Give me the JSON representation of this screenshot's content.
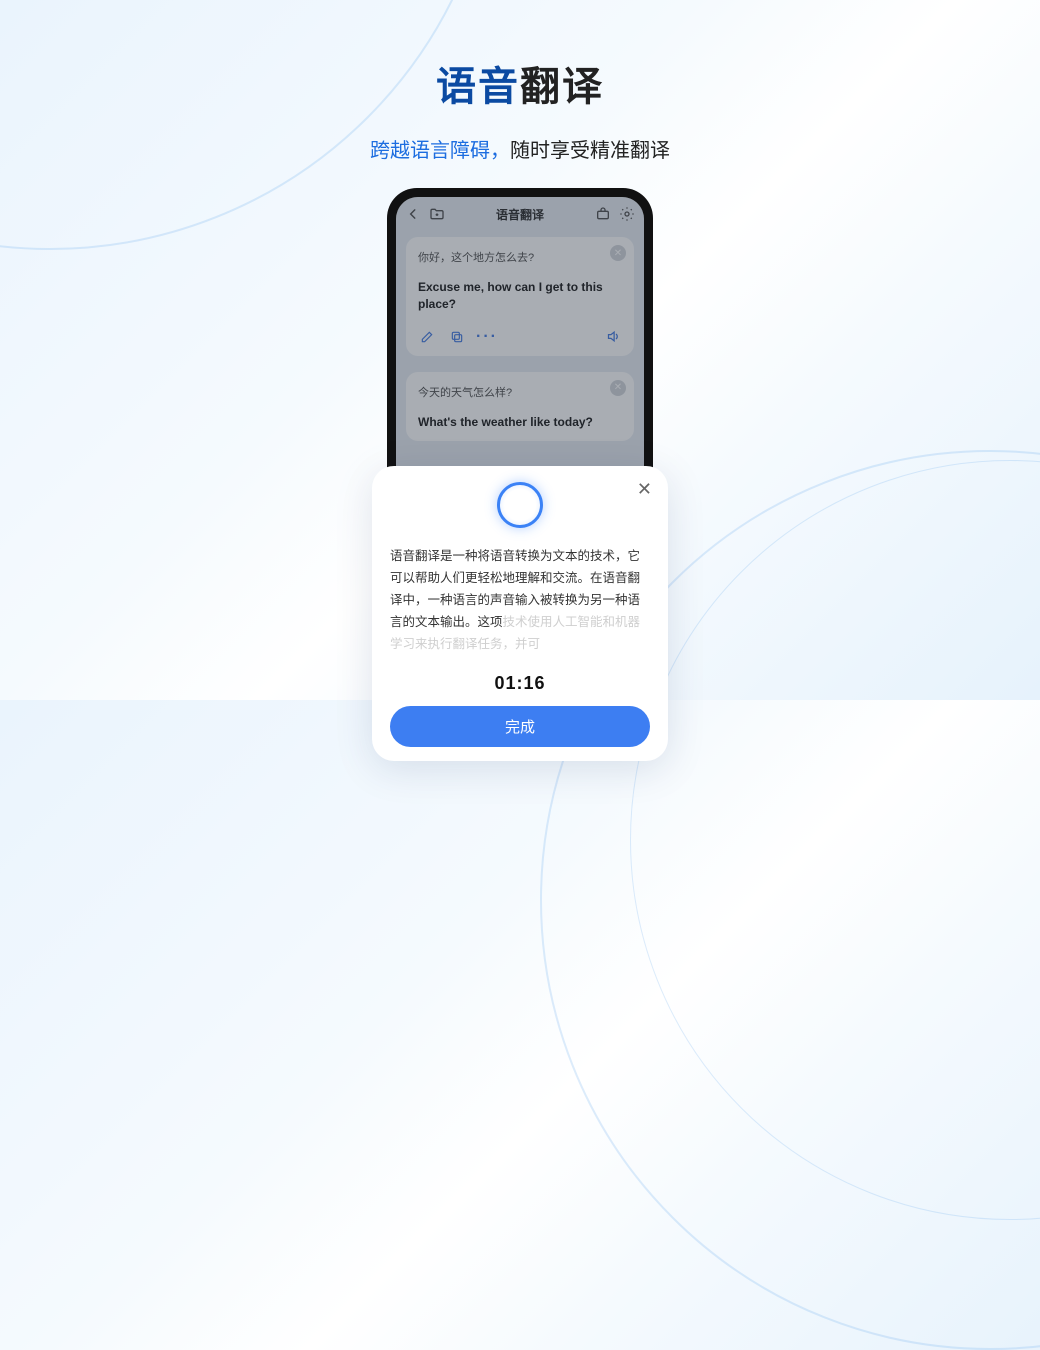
{
  "headline": {
    "part1": "语音",
    "part2": "翻译"
  },
  "subtitle": {
    "part1": "跨越语言障碍，",
    "part2": "随时享受精准翻译"
  },
  "app": {
    "title": "语音翻译",
    "cards": [
      {
        "src": "你好，这个地方怎么去?",
        "dst": "Excuse me, how can I get to this place?"
      },
      {
        "src": "今天的天气怎么样?",
        "dst": "What's the weather like today?"
      }
    ]
  },
  "sheet": {
    "body_main": "语音翻译是一种将语音转换为文本的技术，它可以帮助人们更轻松地理解和交流。在语音翻译中，一种语言的声音输入被转换为另一种语言的文本输出。这项",
    "body_fade": "技术使用人工智能和机器学习来执行翻译任务，并可",
    "timer": "01:16",
    "done": "完成",
    "close": "✕"
  },
  "icons": {
    "back": "chevron-left",
    "folder": "new-folder",
    "briefcase": "toolkit",
    "settings": "gear",
    "edit": "pencil",
    "copy": "copy",
    "more": "…",
    "speaker": "speaker"
  }
}
